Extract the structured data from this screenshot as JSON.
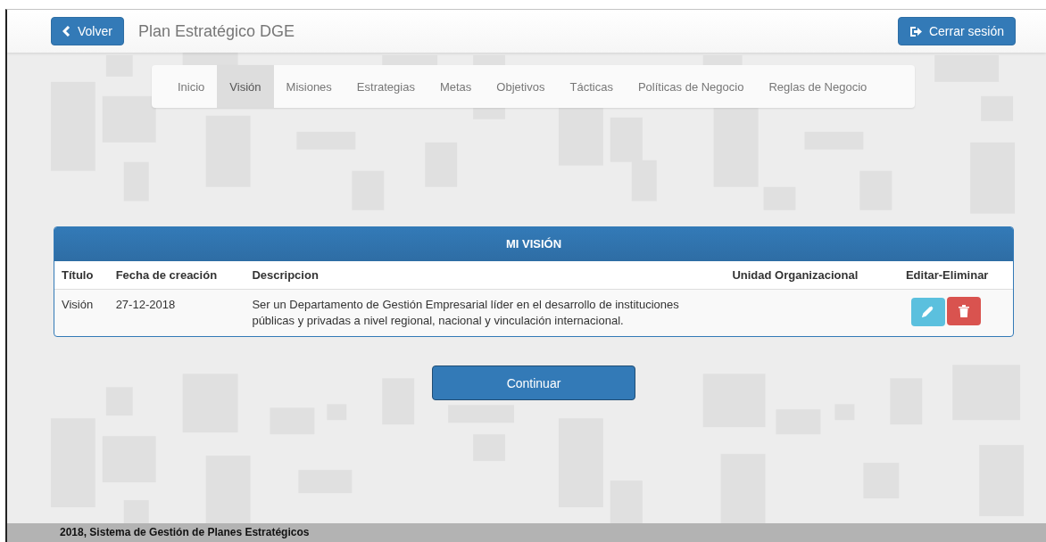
{
  "navbar": {
    "back_button": "Volver",
    "title": "Plan Estratégico DGE",
    "logout_button": "Cerrar sesión"
  },
  "tabs": [
    {
      "label": "Inicio",
      "selected": false
    },
    {
      "label": "Visión",
      "selected": true
    },
    {
      "label": "Misiones",
      "selected": false
    },
    {
      "label": "Estrategias",
      "selected": false
    },
    {
      "label": "Metas",
      "selected": false
    },
    {
      "label": "Objetivos",
      "selected": false
    },
    {
      "label": "Tácticas",
      "selected": false
    },
    {
      "label": "Políticas de Negocio",
      "selected": false
    },
    {
      "label": "Reglas de Negocio",
      "selected": false
    }
  ],
  "panel": {
    "title": "MI VISIÓN",
    "table": {
      "columns": [
        "Título",
        "Fecha de creación",
        "Descripcion",
        "Unidad Organizacional",
        "Editar-Eliminar"
      ],
      "rows": [
        {
          "titulo": "Visión",
          "fecha": "27-12-2018",
          "descripcion": "Ser un Departamento de Gestión Empresarial líder en el desarrollo de instituciones públicas y privadas a nivel regional, nacional y vinculación internacional."
        }
      ]
    }
  },
  "continue_button": "Continuar",
  "footer": "2018, Sistema de Gestión de Planes Estratégicos"
}
